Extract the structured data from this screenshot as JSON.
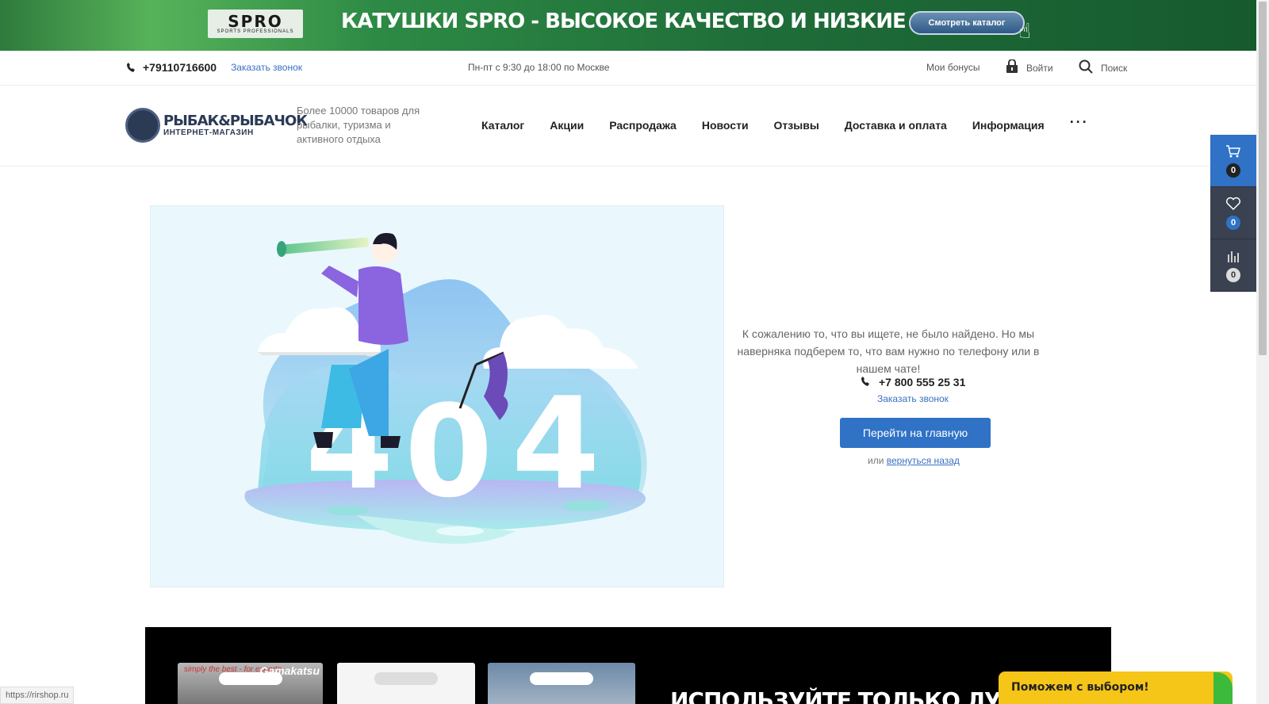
{
  "promo": {
    "logo_main": "SPRO",
    "logo_sub": "SPORTS PROFESSIONALS",
    "title": "КАТУШКИ SPRO - ВЫСОКОЕ КАЧЕСТВО И НИЗКИЕ ЦЕНЫ",
    "button": "Смотреть каталог"
  },
  "topbar": {
    "phone": "+79110716600",
    "callback": "Заказать звонок",
    "hours": "Пн-пт с 9:30 до 18:00 по Москве",
    "bonus": "Мои бонусы",
    "login": "Войти",
    "search": "Поиск"
  },
  "header": {
    "brand_main": "РЫБАК&РЫБАЧОК",
    "brand_sub": "ИНТЕРНЕТ-МАГАЗИН",
    "tagline": "Более 10000 товаров для рыбалки, туризма и активного отдыха",
    "nav": [
      "Каталог",
      "Акции",
      "Распродажа",
      "Новости",
      "Отзывы",
      "Доставка и оплата",
      "Информация"
    ],
    "more": "···"
  },
  "side_panel": {
    "cart_count": "0",
    "favorites_count": "0",
    "compare_count": "0"
  },
  "error": {
    "code": "404",
    "message": "К сожалению то, что вы ищете, не было найдено. Но мы наверняка подберем то, что вам нужно по телефону или в нашем чате!",
    "phone": "+7 800 555 25 31",
    "callback": "Заказать звонок",
    "home_button": "Перейти на главную",
    "back_prefix": "или",
    "back_link": "вернуться назад"
  },
  "bottom_banner": {
    "product1_tagline": "simply the best - for experts",
    "product1_brand": "Gamakatsu",
    "title": "ИСПОЛЬЗУЙТЕ ТОЛЬКО ЛУЧШЕЕ!"
  },
  "help_widget": {
    "label": "Поможем с выбором!"
  },
  "status_url": "https://rirshop.ru",
  "colors": {
    "accent": "#2f72c6",
    "side_panel": "#3a4150",
    "help": "#f5c518"
  }
}
